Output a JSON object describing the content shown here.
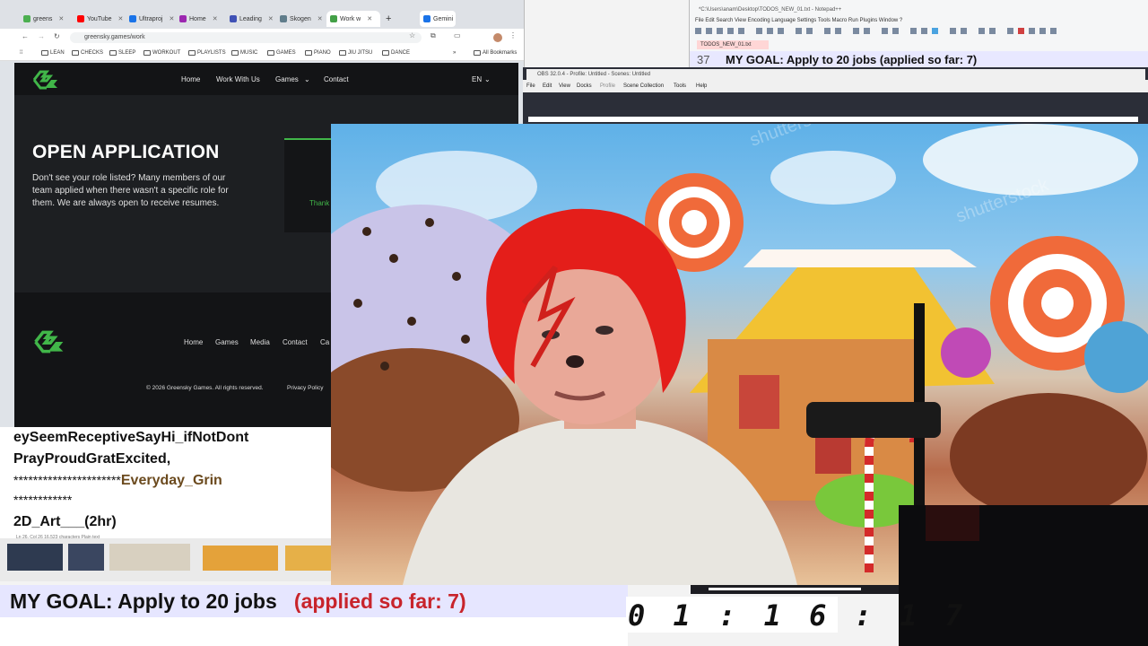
{
  "browser": {
    "tabs": [
      {
        "label": "greens",
        "color": "#4caf50"
      },
      {
        "label": "YouTube",
        "color": "#ff0000"
      },
      {
        "label": "Ultraproj",
        "color": "#1a73e8"
      },
      {
        "label": "Home",
        "color": "#9c27b0"
      },
      {
        "label": "Leading",
        "color": "#3f51b5"
      },
      {
        "label": "Skogen",
        "color": "#607d8b"
      },
      {
        "label": "Work w",
        "color": "#43a047"
      },
      {
        "label": "Gemini",
        "color": "#1a73e8"
      }
    ],
    "url": "greensky.games/work",
    "bookmarks": [
      "LEAN",
      "CHECKS",
      "SLEEP",
      "WORKOUT",
      "PLAYLISTS",
      "MUSIC",
      "GAMES",
      "PIANO",
      "JIU JITSU",
      "DANCE"
    ],
    "all_bookmarks": "All Bookmarks"
  },
  "site": {
    "nav": [
      "Home",
      "Work With Us",
      "Games",
      "Contact"
    ],
    "lang": "EN",
    "title": "OPEN APPLICATION",
    "description": "Don't see your role listed? Many members of our team applied when there wasn't a specific role for them. We are always open to receive resumes.",
    "thanks": "Thank",
    "footer_nav": [
      "Home",
      "Games",
      "Media",
      "Contact",
      "Ca"
    ],
    "copyright": "© 2026 Greensky Games. All rights reserved.",
    "privacy": "Privacy Policy"
  },
  "notes": {
    "line1": "eySeemReceptiveSayHi_ifNotDont",
    "line2": "PrayProudGratExcited,",
    "line3_stars": "**********************",
    "line3_text": "Everyday_Grin",
    "line4": "************",
    "line5": "2D_Art___(2hr)",
    "status": "Ln 26, Col 26     16,523 characters                    Plain text"
  },
  "npp": {
    "title": "*C:\\Users\\anam\\Desktop\\TODOS_NEW_01.txt - Notepad++",
    "menu": "File  Edit  Search  View  Encoding  Language  Settings  Tools  Macro  Run  Plugins  Window  ?",
    "tab": "TODOS_NEW_01.txt",
    "line_number": "37",
    "goal_line": "MY GOAL:  Apply to 20 jobs   (applied so far: 7)"
  },
  "obs": {
    "title": "OBS 32.0.4 - Profile: Untitled - Scenes: Untitled",
    "menu": [
      "File",
      "Edit",
      "View",
      "Docks",
      "Profile",
      "Scene Collection",
      "Tools",
      "Help"
    ]
  },
  "goal": {
    "prefix": "MY GOAL:  Apply to 20 jobs",
    "progress": "(applied so far: 7)",
    "accent": "#c8242b"
  },
  "timer": "0 1 : 1 6 : 1 7"
}
